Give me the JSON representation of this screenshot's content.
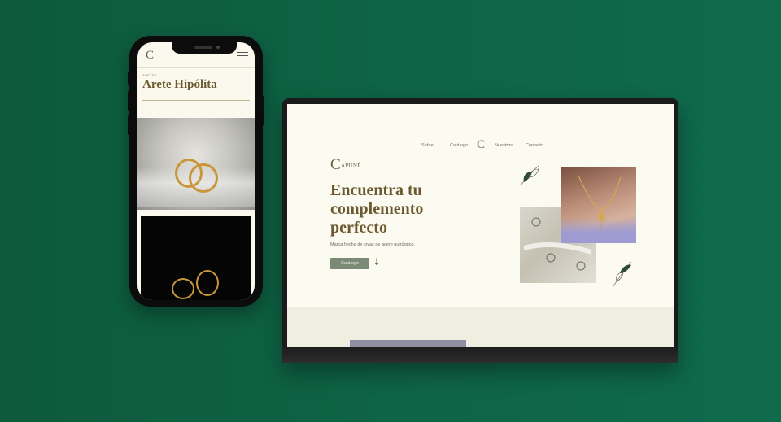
{
  "phone": {
    "logo": "C",
    "breadcrumb": "ARETES",
    "product_title": "Arete Hipólita"
  },
  "laptop": {
    "nav": {
      "items": [
        "Sobre ...",
        "Catálogo",
        "Nuestros",
        "Contacto"
      ],
      "logo": "C"
    },
    "brand": {
      "mark": "C",
      "name": "APUNÉ"
    },
    "hero": {
      "heading_line1": "Encuentra tu",
      "heading_line2": "complemento",
      "heading_line3": "perfecto",
      "subtitle": "Marca hecha de joyas de acero quirúrgico.",
      "cta_label": "Catálogo",
      "cta_arrow": "↓"
    }
  },
  "colors": {
    "background": "#0f6447",
    "page_bg": "#fcfbf1",
    "heading": "#6d5930",
    "cta": "#7a8a74",
    "gold": "#c9973b"
  }
}
